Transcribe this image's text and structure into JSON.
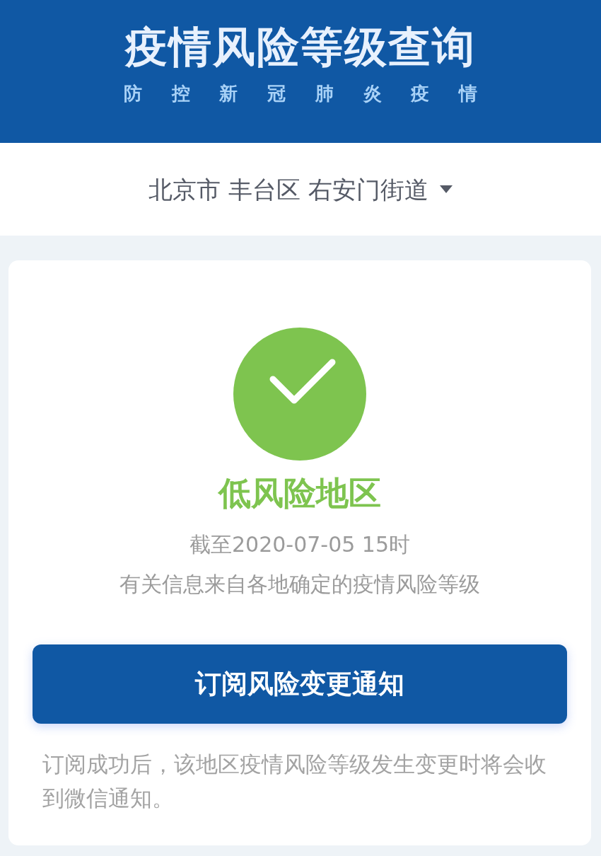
{
  "header": {
    "title": "疫情风险等级查询",
    "subtitle": "防 控 新 冠 肺 炎 疫 情"
  },
  "location": {
    "text": "北京市 丰台区 右安门街道"
  },
  "status": {
    "kind": "low",
    "label": "低风险地区",
    "updated": "截至2020-07-05 15时",
    "source": "有关信息来自各地确定的疫情风险等级"
  },
  "subscribe_button": {
    "label": "订阅风险变更通知"
  },
  "note": "订阅成功后，该地区疫情风险等级发生变更时将会收到微信通知。"
}
